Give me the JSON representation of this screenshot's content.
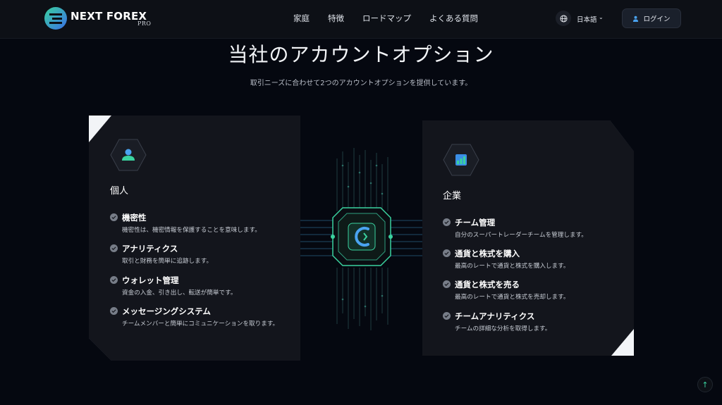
{
  "brand": {
    "name": "NEXT FOREX",
    "sub": "PRO"
  },
  "nav": {
    "links": [
      "家庭",
      "特徴",
      "ロードマップ",
      "よくある質問"
    ]
  },
  "lang": {
    "label": "日本語",
    "icon": "globe-icon",
    "chevron": "chevron-down-icon"
  },
  "login": {
    "label": "ログイン",
    "icon": "user-icon"
  },
  "page": {
    "title": "当社のアカウントオプション",
    "subtitle": "取引ニーズに合わせて2つのアカウントオプションを提供しています。"
  },
  "cards": {
    "individual": {
      "title": "個人",
      "icon": "user-icon",
      "features": [
        {
          "title": "機密性",
          "desc": "機密性は、機密情報を保護することを意味します。"
        },
        {
          "title": "アナリティクス",
          "desc": "取引と財務を簡単に追跡します。"
        },
        {
          "title": "ウォレット管理",
          "desc": "資金の入金、引き出し、転送が簡単です。"
        },
        {
          "title": "メッセージングシステム",
          "desc": "チームメンバーと簡単にコミュニケーションを取ります。"
        }
      ]
    },
    "enterprise": {
      "title": "企業",
      "icon": "chart-icon",
      "features": [
        {
          "title": "チーム管理",
          "desc": "自分のスーパートレーダーチームを管理します。"
        },
        {
          "title": "通貨と株式を購入",
          "desc": "最高のレートで通貨と株式を購入します。"
        },
        {
          "title": "通貨と株式を売る",
          "desc": "最高のレートで通貨と株式を売却します。"
        },
        {
          "title": "チームアナリティクス",
          "desc": "チームの詳細な分析を取得します。"
        }
      ]
    }
  },
  "colors": {
    "accent": "#3ad29f",
    "blue": "#3a8ee6",
    "card": "#13151c",
    "background": "#050810"
  },
  "scroll_top": {
    "icon": "arrow-up-icon",
    "glyph": "↑"
  }
}
